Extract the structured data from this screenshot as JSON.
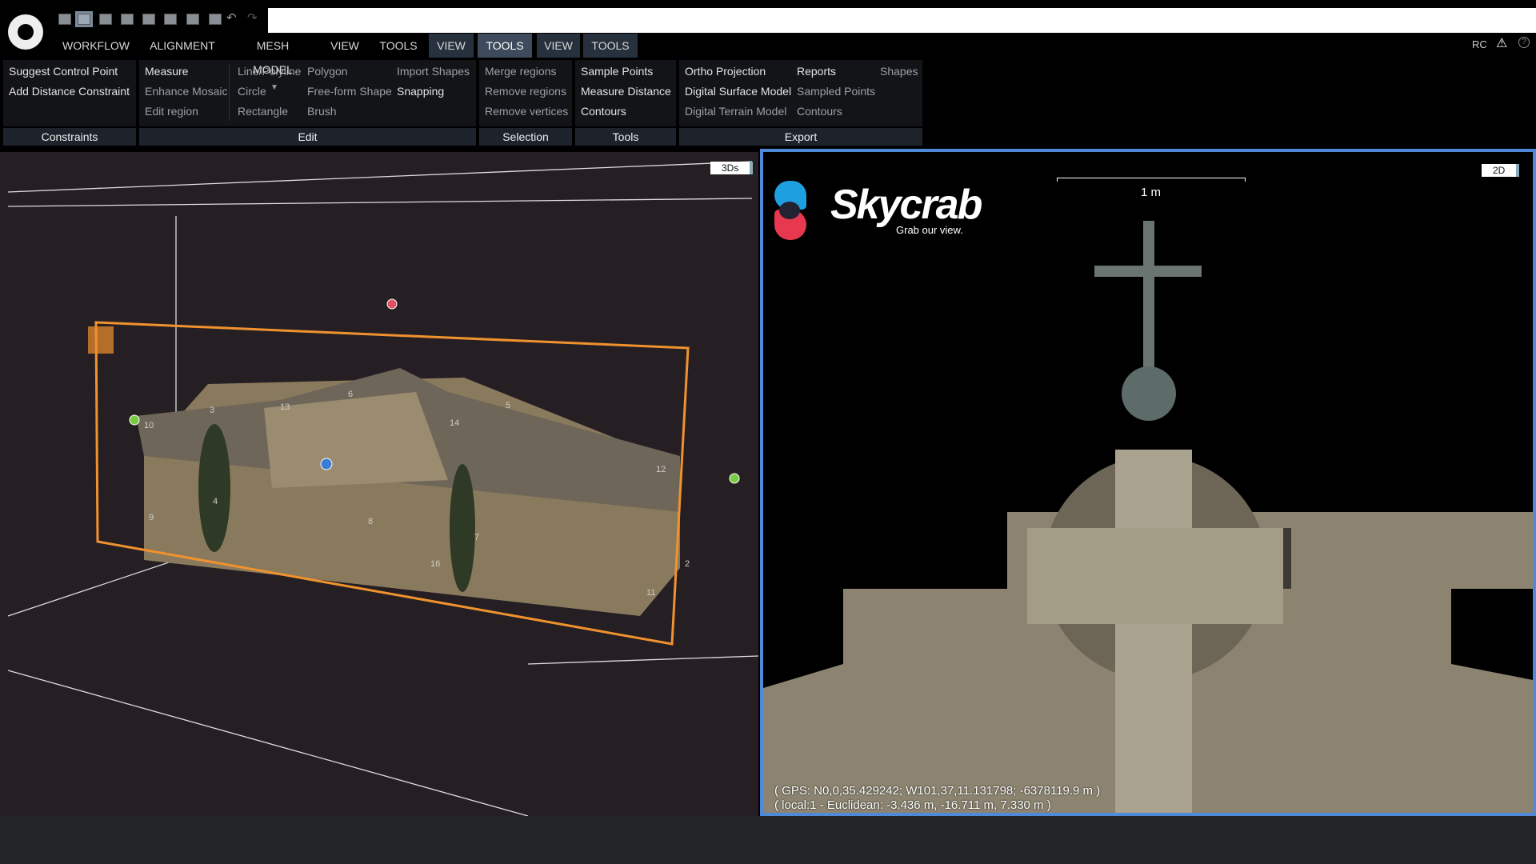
{
  "toolbar": {
    "icons": [
      "layout-1-icon",
      "layout-2-icon",
      "layout-3-icon",
      "layout-4-icon",
      "layout-5-icon",
      "layout-6-icon",
      "layout-7-icon",
      "layout-8-icon",
      "undo-icon",
      "redo-icon"
    ],
    "active_index": 1
  },
  "menu": {
    "tabs": [
      "WORKFLOW",
      "ALIGNMENT",
      "MESH MODEL",
      "VIEW",
      "TOOLS",
      "VIEW",
      "TOOLS",
      "VIEW",
      "TOOLS"
    ],
    "active_index": 6
  },
  "status": {
    "user": "RC"
  },
  "ribbon": {
    "constraints": {
      "label": "Constraints",
      "items": [
        "Suggest Control Point",
        "Add Distance Constraint"
      ]
    },
    "edit": {
      "label": "Edit",
      "items": [
        "Measure",
        "Enhance Mosaic",
        "Edit region",
        "Line/Polyline",
        "Circle",
        "Rectangle",
        "Polygon",
        "Free-form Shape",
        "Brush",
        "Import Shapes",
        "Snapping"
      ]
    },
    "selection": {
      "label": "Selection",
      "items": [
        "Merge regions",
        "Remove regions",
        "Remove vertices"
      ]
    },
    "tools": {
      "label": "Tools",
      "items": [
        "Sample Points",
        "Measure Distance",
        "Contours"
      ]
    },
    "export": {
      "label": "Export",
      "items": [
        "Ortho Projection",
        "Digital Surface Model",
        "Digital Terrain Model",
        "Reports",
        "Sampled Points",
        "Contours",
        "Shapes"
      ]
    }
  },
  "view3d": {
    "badge": "3Ds",
    "point_labels": [
      "10",
      "3",
      "13",
      "6",
      "14",
      "5",
      "4",
      "9",
      "8",
      "7",
      "16",
      "12",
      "2",
      "11"
    ]
  },
  "view2d": {
    "badge": "2D",
    "scale": "1 m",
    "logo": {
      "name": "Skycrab",
      "tagline": "Grab our view."
    },
    "gps": "( GPS: N0,0,35.429242; W101,37,11.131798; -6378119.9 m )",
    "local": "( local:1 - Euclidean: -3.436 m, -16.711 m, 7.330 m )"
  },
  "colors": {
    "accent": "#4f8ad8",
    "bbox": "#f0922e",
    "panel": "#121418"
  }
}
